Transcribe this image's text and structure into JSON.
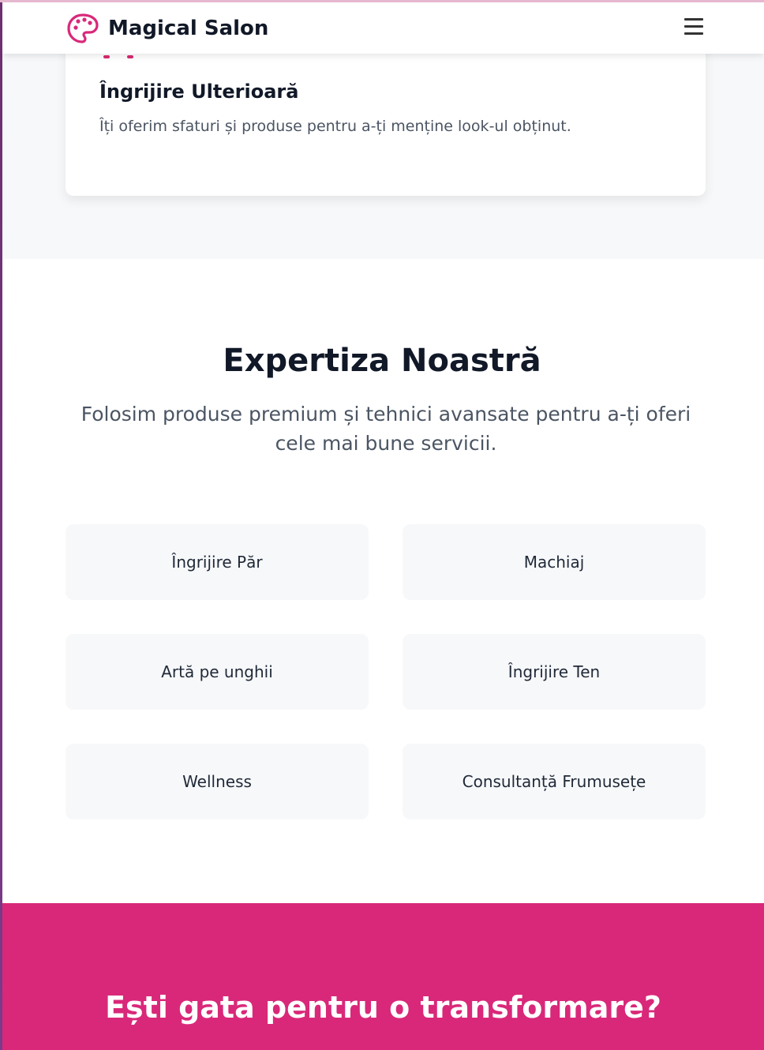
{
  "header": {
    "brand": "Magical Salon",
    "logo_icon": "palette-icon",
    "menu_icon": "hamburger-menu-icon"
  },
  "care_card": {
    "title": "Îngrijire Ulterioară",
    "text": "Îți oferim sfaturi și produse pentru a-ți menține look-ul obținut."
  },
  "expertise": {
    "title": "Expertiza Noastră",
    "subtitle": "Folosim produse premium și tehnici avansate pentru a-ți oferi cele mai bune servicii.",
    "items": [
      {
        "label": "Îngrijire Păr"
      },
      {
        "label": "Machiaj"
      },
      {
        "label": "Artă pe unghii"
      },
      {
        "label": "Îngrijire Ten"
      },
      {
        "label": "Wellness"
      },
      {
        "label": "Consultanță Frumusețe"
      }
    ]
  },
  "cta": {
    "title": "Ești gata pentru o transformare?"
  },
  "colors": {
    "brand_pink": "#d9287a",
    "text_dark": "#111827",
    "text_muted": "#4b5563",
    "tile_bg": "#f7f8fa"
  }
}
